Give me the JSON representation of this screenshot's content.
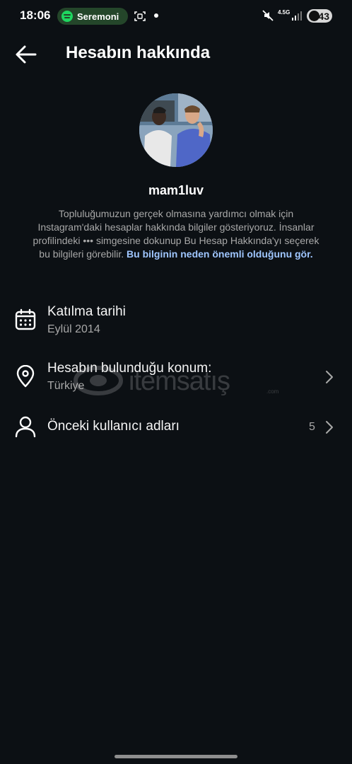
{
  "status_bar": {
    "time": "18:06",
    "media_app_label": "Seremoni",
    "network_label": "4.5G",
    "battery_level": "43",
    "icons": [
      "spotify-icon",
      "screen-record-icon",
      "mute-icon",
      "signal-icon",
      "battery-icon"
    ]
  },
  "header": {
    "title": "Hesabın hakkında",
    "back_icon": "arrow-left-icon"
  },
  "profile": {
    "username": "mam1luv",
    "description": "Topluluğumuzun gerçek olmasına yardımcı olmak için Instagram'daki hesaplar hakkında bilgiler gösteriyoruz. İnsanlar profilindeki ••• simgesine dokunup Bu Hesap Hakkında'yı seçerek bu bilgileri görebilir.",
    "learn_more_link": "Bu bilginin neden önemli olduğunu gör."
  },
  "rows": [
    {
      "icon": "calendar-icon",
      "title": "Katılma tarihi",
      "subtitle": "Eylül 2014"
    },
    {
      "icon": "location-pin-icon",
      "title": "Hesabın bulunduğu konum:",
      "subtitle": "Türkiye"
    },
    {
      "icon": "person-icon",
      "title": "Önceki kullanıcı adları",
      "count": "5"
    }
  ],
  "watermark": {
    "text": "itemsatış",
    "suffix": ".com"
  },
  "colors": {
    "background": "#0c1014",
    "link": "#9fc6ff",
    "secondary_text": "#a8a8a8"
  }
}
